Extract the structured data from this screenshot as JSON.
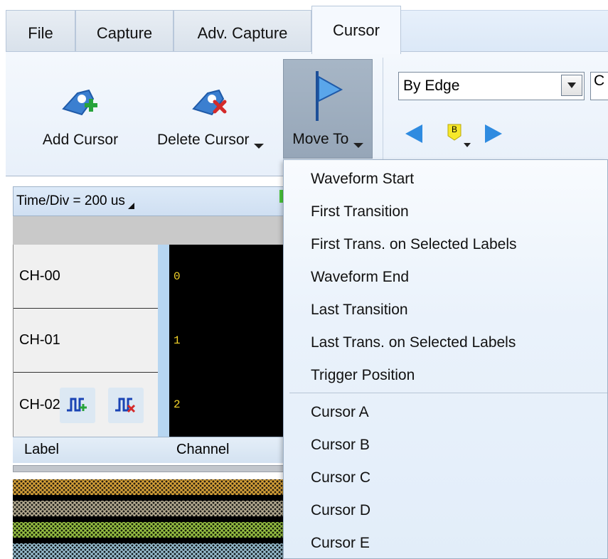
{
  "tabs": [
    {
      "label": "File"
    },
    {
      "label": "Capture"
    },
    {
      "label": "Adv. Capture"
    },
    {
      "label": "Cursor"
    }
  ],
  "ribbon": {
    "add_cursor": "Add Cursor",
    "delete_cursor": "Delete Cursor",
    "move_to": "Move To",
    "edge_select_value": "By Edge",
    "second_select_value": "C",
    "cursor_marker_letter": "B"
  },
  "waveform": {
    "time_div": "Time/Div = 200 us",
    "channels": [
      {
        "label": "CH-00",
        "num": "0"
      },
      {
        "label": "CH-01",
        "num": "1"
      },
      {
        "label": "CH-02",
        "num": "2"
      }
    ],
    "footer_label": "Label",
    "footer_channel": "Channel"
  },
  "menu": {
    "group1": [
      "Waveform Start",
      "First Transition",
      "First Trans. on Selected Labels",
      "Waveform End",
      "Last Transition",
      "Last Trans. on Selected Labels",
      "Trigger Position"
    ],
    "group2": [
      "Cursor A",
      "Cursor B",
      "Cursor C",
      "Cursor D",
      "Cursor E"
    ]
  },
  "colors": {
    "accent_blue": "#1e6fd0",
    "wave_colors": [
      "#c8962c",
      "#a9a08a",
      "#8cb43c",
      "#8fb6c8"
    ]
  }
}
